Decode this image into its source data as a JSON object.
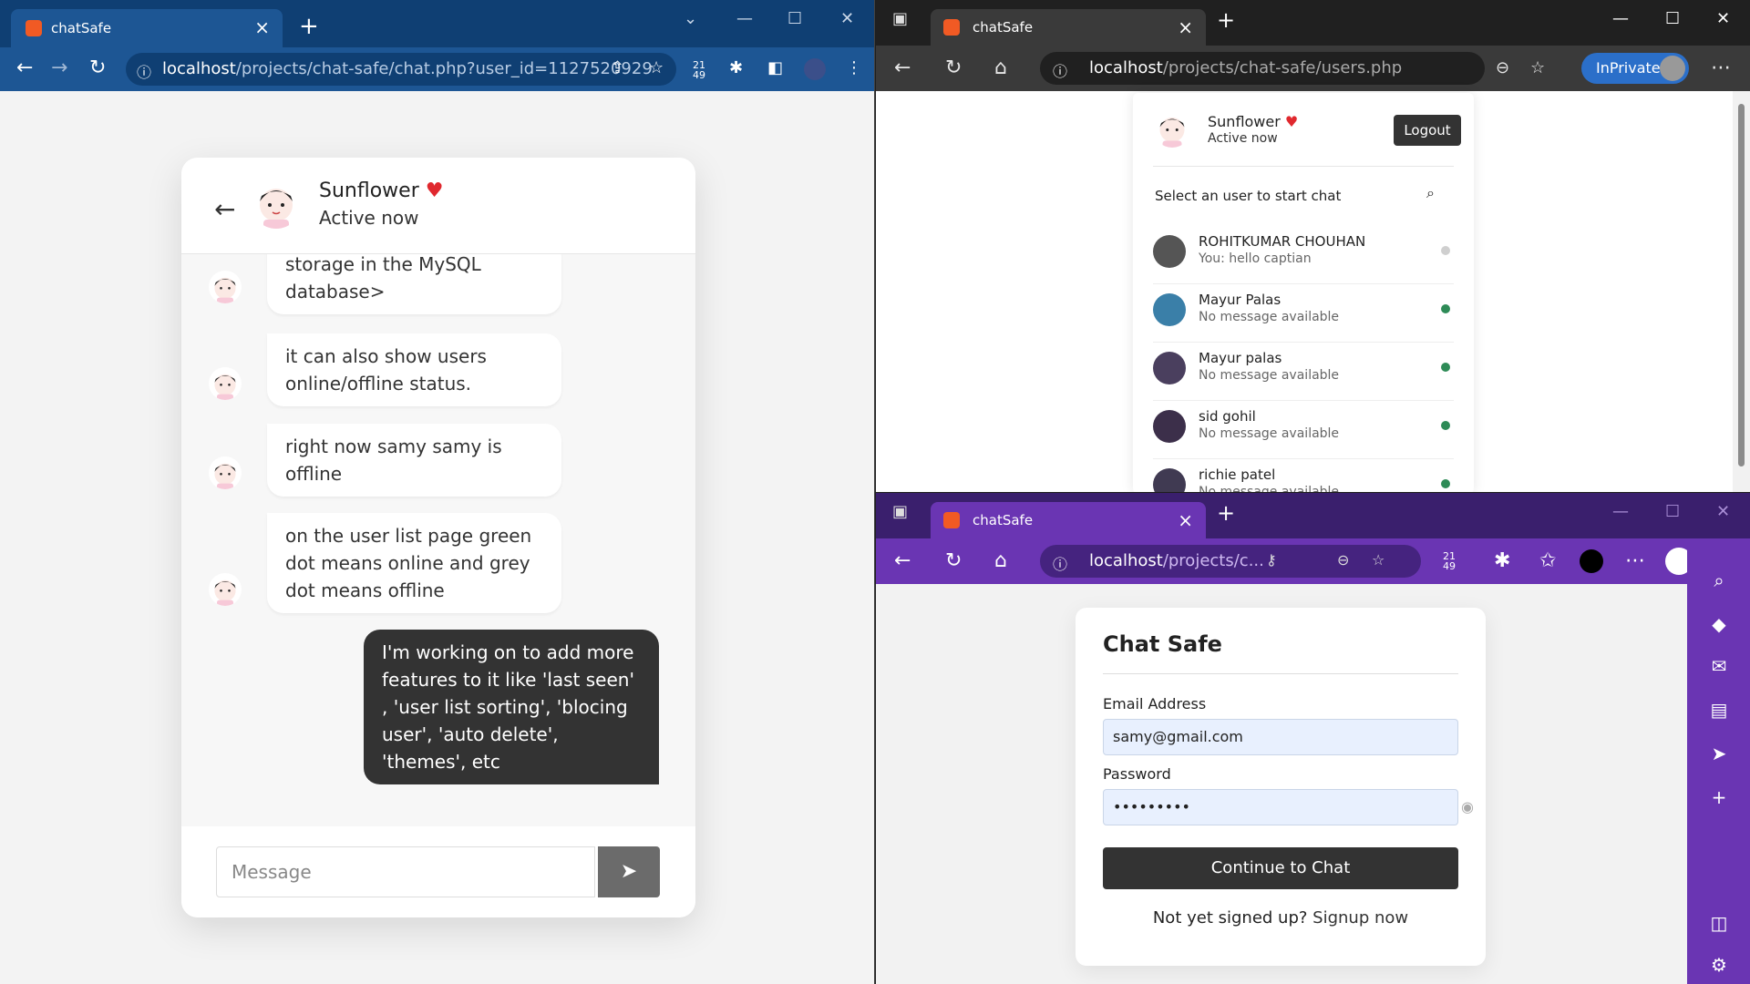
{
  "left_window": {
    "tab_title": "chatSafe",
    "url_host": "localhost",
    "url_path": "/projects/chat-safe/chat.php?user_id=1127520929",
    "ext_badge": "21\n49",
    "chat": {
      "user_name": "Sunflower",
      "heart": "♥",
      "status": "Active now",
      "messages": [
        {
          "dir": "in",
          "text": "storage in the MySQL database>"
        },
        {
          "dir": "in",
          "text": "it can also show users online/offline status."
        },
        {
          "dir": "in",
          "text": "right now samy samy is offline"
        },
        {
          "dir": "in",
          "text": "on the user list page green dot means online and grey dot means offline"
        },
        {
          "dir": "out",
          "text": "I'm working on to add more features to it like 'last seen' , 'user list sorting', 'blocing user', 'auto delete', 'themes', etc"
        }
      ],
      "input_placeholder": "Message",
      "send_icon": "➤"
    }
  },
  "right_top_window": {
    "tab_title": "chatSafe",
    "url_host": "localhost",
    "url_path": "/projects/chat-safe/users.php",
    "inprivate_label": "InPrivate",
    "current_user": {
      "name": "Sunflower",
      "heart": "♥",
      "status": "Active now"
    },
    "logout_label": "Logout",
    "search_prompt": "Select an user to start chat",
    "users": [
      {
        "name": "ROHITKUMAR CHOUHAN",
        "last": "You: hello captian",
        "status": "offline"
      },
      {
        "name": "Mayur Palas",
        "last": "No message available",
        "status": "online"
      },
      {
        "name": "Mayur palas",
        "last": "No message available",
        "status": "online"
      },
      {
        "name": "sid gohil",
        "last": "No message available",
        "status": "online"
      },
      {
        "name": "richie patel",
        "last": "No message available",
        "status": "online"
      }
    ],
    "colors": {
      "online": "#2e8b57",
      "offline": "#cfcfcf"
    }
  },
  "right_bottom_window": {
    "tab_title": "chatSafe",
    "url_host": "localhost",
    "url_path": "/projects/c...",
    "ext_badge": "21\n49",
    "login": {
      "heading": "Chat Safe",
      "email_label": "Email Address",
      "email_value": "samy@gmail.com",
      "password_label": "Password",
      "password_value": "•••••••••",
      "submit_label": "Continue to Chat",
      "signup_prompt": "Not yet signed up?",
      "signup_link": "Signup now"
    }
  }
}
